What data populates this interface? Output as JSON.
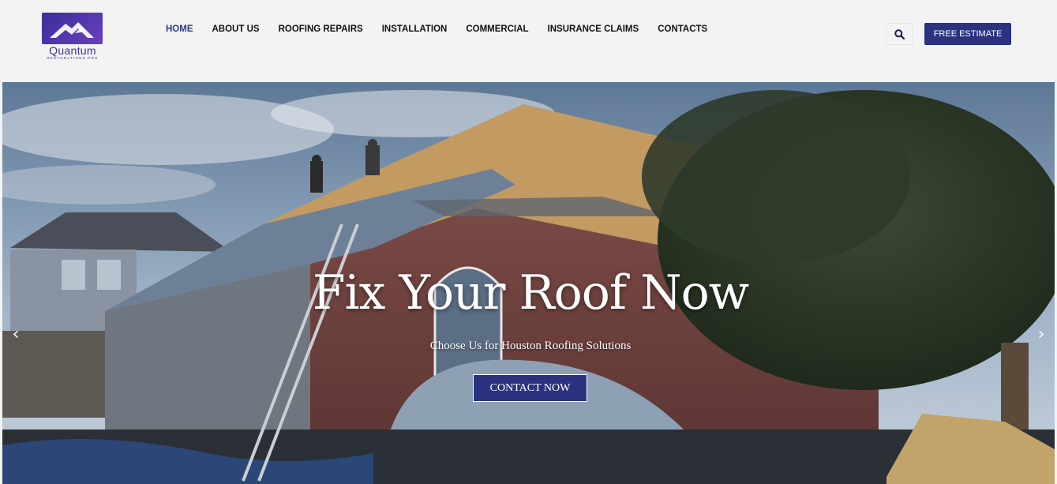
{
  "brand": {
    "name": "Quantum",
    "tagline": "RESTORATIONS PRO",
    "accent": "#2b3380",
    "logo_color": "#5a3aa8"
  },
  "nav": {
    "items": [
      {
        "label": "HOME",
        "active": true
      },
      {
        "label": "ABOUT US"
      },
      {
        "label": "ROOFING REPAIRS"
      },
      {
        "label": "INSTALLATION"
      },
      {
        "label": "COMMERCIAL"
      },
      {
        "label": "INSURANCE CLAIMS"
      },
      {
        "label": "CONTACTS"
      }
    ],
    "search_icon": "search-icon",
    "estimate_label": "FREE ESTIMATE"
  },
  "hero": {
    "title": "Fix Your Roof Now",
    "subtitle": "Choose Us for Houston Roofing Solutions",
    "cta_label": "CONTACT NOW",
    "prev_icon": "chevron-left-icon",
    "next_icon": "chevron-right-icon",
    "prev_glyph": "‹",
    "next_glyph": "›"
  }
}
